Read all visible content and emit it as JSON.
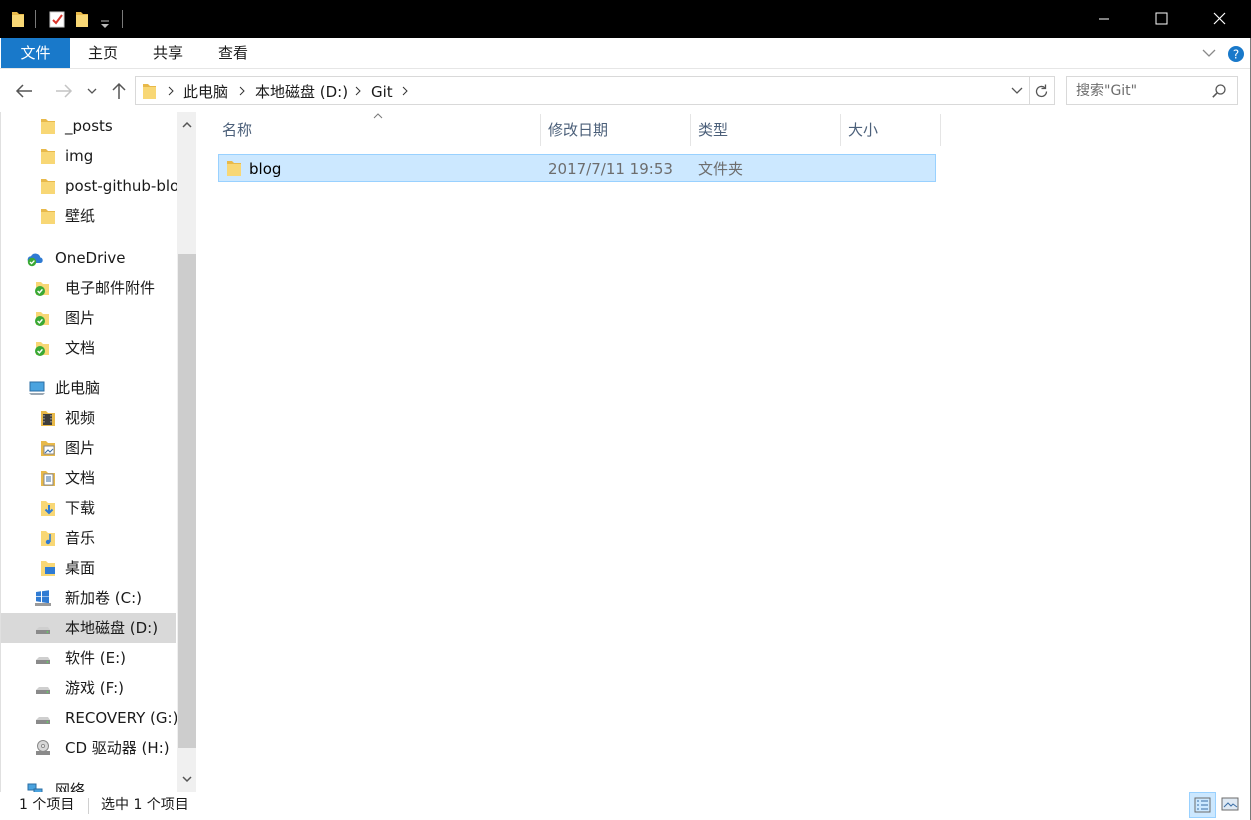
{
  "ribbon": {
    "tabs": [
      "文件",
      "主页",
      "共享",
      "查看"
    ]
  },
  "address": {
    "crumbs": [
      "此电脑",
      "本地磁盘 (D:)",
      "Git"
    ]
  },
  "search": {
    "placeholder": "搜索\"Git\""
  },
  "sidebar": {
    "items": [
      {
        "label": "_posts",
        "icon": "folder-icon"
      },
      {
        "label": "img",
        "icon": "folder-icon"
      },
      {
        "label": "post-github-blo",
        "icon": "folder-icon"
      },
      {
        "label": "壁纸",
        "icon": "folder-icon"
      },
      {
        "label": "OneDrive",
        "icon": "onedrive-cloud-icon"
      },
      {
        "label": "电子邮件附件",
        "icon": "synced-folder-icon"
      },
      {
        "label": "图片",
        "icon": "synced-folder-icon"
      },
      {
        "label": "文档",
        "icon": "synced-folder-icon"
      },
      {
        "label": "此电脑",
        "icon": "this-pc-icon"
      },
      {
        "label": "视频",
        "icon": "videos-folder-icon"
      },
      {
        "label": "图片",
        "icon": "pictures-folder-icon"
      },
      {
        "label": "文档",
        "icon": "documents-folder-icon"
      },
      {
        "label": "下载",
        "icon": "downloads-folder-icon"
      },
      {
        "label": "音乐",
        "icon": "music-folder-icon"
      },
      {
        "label": "桌面",
        "icon": "desktop-folder-icon"
      },
      {
        "label": "新加卷 (C:)",
        "icon": "windows-drive-icon"
      },
      {
        "label": "本地磁盘 (D:)",
        "icon": "drive-icon"
      },
      {
        "label": "软件 (E:)",
        "icon": "drive-icon"
      },
      {
        "label": "游戏 (F:)",
        "icon": "drive-icon"
      },
      {
        "label": "RECOVERY (G:)",
        "icon": "drive-icon"
      },
      {
        "label": "CD 驱动器 (H:)",
        "icon": "cd-drive-icon"
      },
      {
        "label": "网络",
        "icon": "network-icon"
      }
    ]
  },
  "columns": {
    "name": "名称",
    "modified": "修改日期",
    "type": "类型",
    "size": "大小"
  },
  "files": [
    {
      "name": "blog",
      "modified": "2017/7/11 19:53",
      "type": "文件夹",
      "size": ""
    }
  ],
  "status": {
    "count": "1 个项目",
    "selected": "选中 1 个项目"
  },
  "colors": {
    "accent": "#1979ca",
    "selection": "#cce8ff",
    "selection_border": "#99d1ff",
    "folder": "#f8d775"
  }
}
